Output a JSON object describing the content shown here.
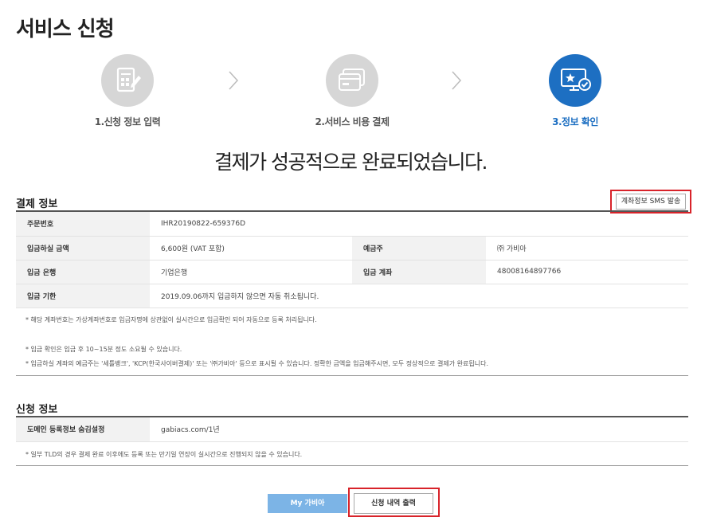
{
  "page_title": "서비스 신청",
  "steps": [
    {
      "label": "1.신청 정보 입력",
      "icon": "form-edit-icon",
      "active": false
    },
    {
      "label": "2.서비스 비용 결제",
      "icon": "payment-cards-icon",
      "active": false
    },
    {
      "label": "3.정보 확인",
      "icon": "monitor-check-icon",
      "active": true
    }
  ],
  "success_message": "결제가 성공적으로 완료되었습니다.",
  "payment": {
    "section_title": "결제 정보",
    "sms_button": "계좌정보 SMS 발송",
    "order_no_label": "주문번호",
    "order_no": "IHR20190822-659376D",
    "amount_label": "입금하실 금액",
    "amount": "6,600원 (VAT 포함)",
    "depositor_label": "예금주",
    "depositor": "㈜ 가비아",
    "bank_label": "입금 은행",
    "bank": "기업은행",
    "account_label": "입금 계좌",
    "account": "48008164897766",
    "deadline_label": "입금 기한",
    "deadline": "2019.09.06까지 입금하지 않으면 자동 취소됩니다.",
    "notes": [
      "* 해당 계좌번호는 가상계좌번호로 입금자명에 상관없이 실시간으로 입금확인 되어 자동으로 등록 처리됩니다.",
      "* 입금 확인은 입금 후 10~15분 정도 소요될 수 있습니다.",
      "* 입금하실 계좌의 예금주는 '세틀뱅크', 'KCP(한국사이버결제)' 또는 '㈜가비아' 등으로 표시될 수 있습니다. 정확한 금액을 입금해주시면, 모두 정상적으로 결제가 완료됩니다."
    ]
  },
  "application": {
    "section_title": "신청 정보",
    "domain_label": "도메인 등록정보 숨김설정",
    "domain_value": "gabiacs.com/1년",
    "note": "* 일부 TLD의 경우 결제 완료 이후에도 등록 또는 만기일 연장이 실시간으로 진행되지 않을 수 있습니다."
  },
  "buttons": {
    "my_gabia": "My 가비아",
    "print": "신청 내역 출력"
  },
  "colors": {
    "accent": "#1d6fc2",
    "inactive_step": "#d6d6d6",
    "highlight_box": "#d8232a",
    "my_button": "#7cb4e6"
  }
}
